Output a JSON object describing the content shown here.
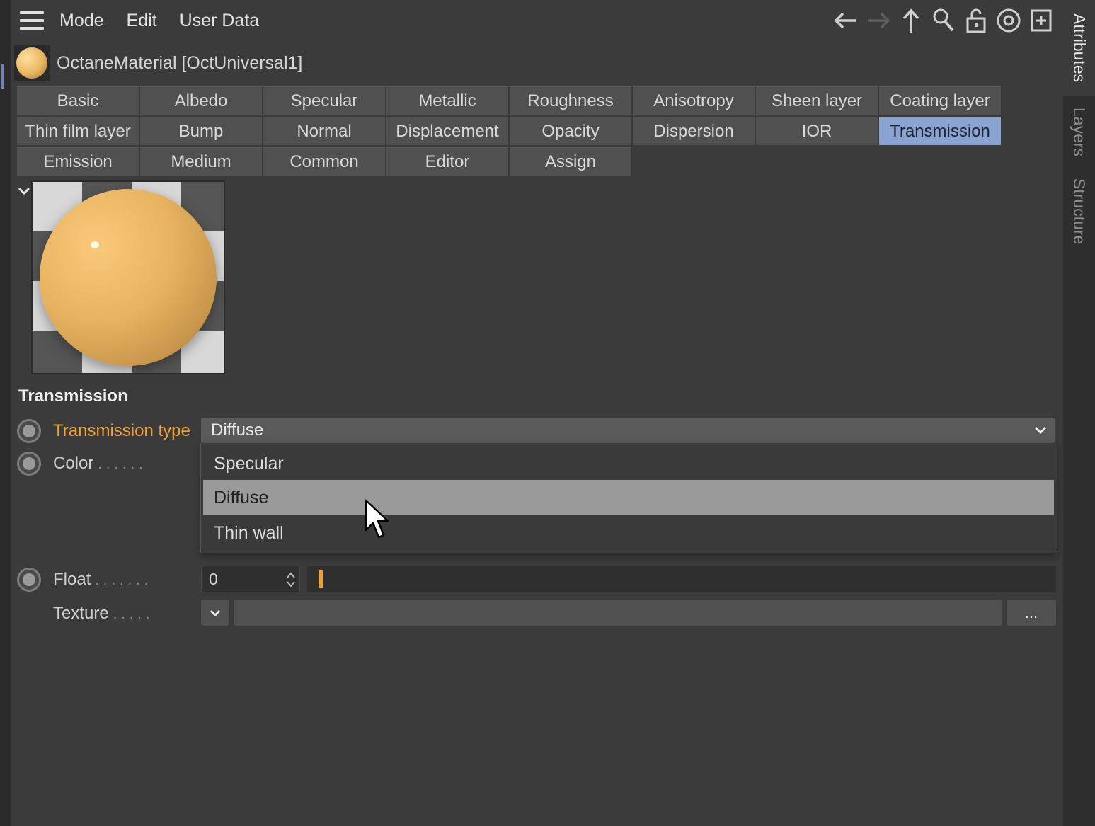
{
  "menu": {
    "items": [
      "Mode",
      "Edit",
      "User Data"
    ]
  },
  "toolbar": {
    "icons": [
      "back-arrow-icon",
      "forward-arrow-icon",
      "up-arrow-icon",
      "search-icon",
      "lock-icon",
      "target-icon",
      "new-panel-icon"
    ]
  },
  "material": {
    "title": "OctaneMaterial [OctUniversal1]"
  },
  "tabs": {
    "row1": [
      "Basic",
      "Albedo",
      "Specular",
      "Metallic",
      "Roughness",
      "Anisotropy",
      "Sheen layer",
      "Coating layer"
    ],
    "row2": [
      "Thin film layer",
      "Bump",
      "Normal",
      "Displacement",
      "Opacity",
      "Dispersion",
      "IOR",
      "Transmission"
    ],
    "row3": [
      "Emission",
      "Medium",
      "Common",
      "Editor",
      "Assign"
    ],
    "active": "Transmission"
  },
  "section": {
    "title": "Transmission"
  },
  "params": {
    "transmission_type": {
      "label": "Transmission type",
      "value": "Diffuse"
    },
    "color": {
      "label": "Color"
    },
    "float": {
      "label": "Float",
      "value": "0",
      "level": 0
    },
    "texture": {
      "label": "Texture",
      "more": "..."
    }
  },
  "dropdown": {
    "options": [
      "Specular",
      "Diffuse",
      "Thin wall"
    ],
    "selected": "Diffuse"
  },
  "right_tabs": [
    "Attributes",
    "Layers",
    "Structure"
  ],
  "colors": {
    "accent_orange": "#f0a339",
    "active_tab": "#8aa3d1",
    "panel_bg": "#3b3b3b"
  }
}
